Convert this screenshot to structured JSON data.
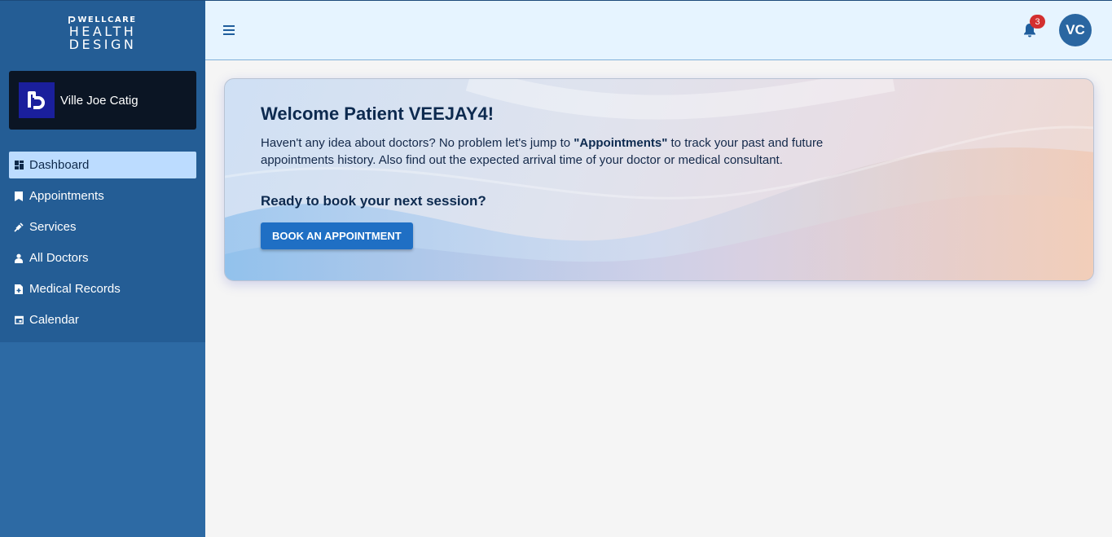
{
  "logo": {
    "line1": "WELLCARE",
    "line2": "HEALTH",
    "line3": "DESIGN"
  },
  "user": {
    "name": "Ville Joe Catig"
  },
  "nav": {
    "items": [
      {
        "label": "Dashboard",
        "icon": "dashboard-icon",
        "active": true
      },
      {
        "label": "Appointments",
        "icon": "bookmark-icon"
      },
      {
        "label": "Services",
        "icon": "syringe-icon"
      },
      {
        "label": "All Doctors",
        "icon": "doctor-icon"
      },
      {
        "label": "Medical Records",
        "icon": "medical-file-icon"
      },
      {
        "label": "Calendar",
        "icon": "calendar-icon"
      }
    ]
  },
  "header": {
    "notification_count": "3",
    "avatar_initials": "VC"
  },
  "welcome": {
    "title": "Welcome Patient VEEJAY4!",
    "text_before": "Haven't any idea about doctors? No problem let's jump to ",
    "text_bold": "\"Appointments\"",
    "text_after": " to track your past and future appointments history. Also find out the expected arrival time of your doctor or medical consultant.",
    "subtitle": "Ready to book your next session?",
    "button_label": "BOOK AN APPOINTMENT"
  },
  "colors": {
    "sidebar": "#2d6aa4",
    "sidebar_top": "#245d95",
    "header": "#e6f4ff",
    "active_nav": "#bcdcff",
    "primary_button": "#1f6fc4",
    "badge": "#d32f2f"
  }
}
